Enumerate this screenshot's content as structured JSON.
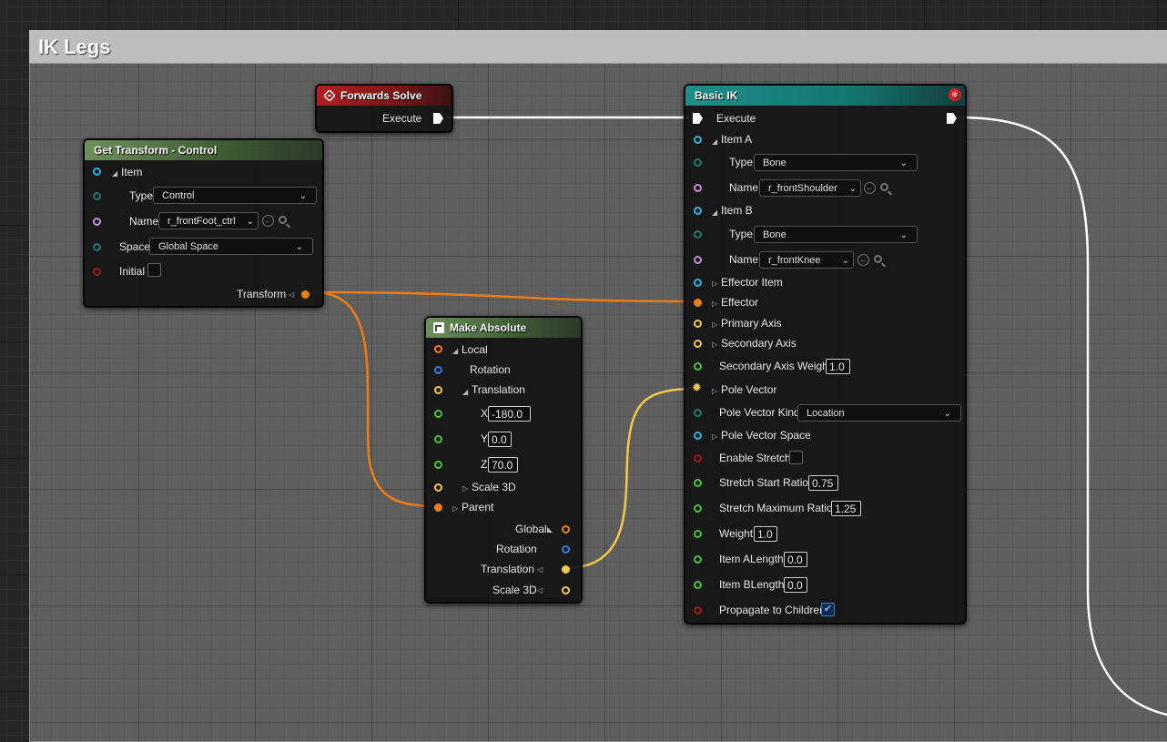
{
  "comment": {
    "title": "IK Legs"
  },
  "colors": {
    "exec": "#ffffff",
    "transform": "#f07d14",
    "vector": "#f5c84a",
    "rotation": "#2f7fe0",
    "item": "#2ab6e0",
    "type": "#1e7a70",
    "name": "#c58be0",
    "bool": "#a01818",
    "float": "#49c43a"
  },
  "forwards_solve": {
    "title": "Forwards Solve",
    "execute": "Execute"
  },
  "get_transform": {
    "title": "Get Transform - Control",
    "item": "Item",
    "type_label": "Type",
    "type_value": "Control",
    "name_label": "Name",
    "name_value": "r_frontFoot_ctrl",
    "space_label": "Space",
    "space_value": "Global Space",
    "initial_label": "Initial",
    "transform_label": "Transform"
  },
  "make_absolute": {
    "title": "Make Absolute",
    "local": "Local",
    "rotation": "Rotation",
    "translation": "Translation",
    "x_label": "X",
    "x_value": "-180.0",
    "y_label": "Y",
    "y_value": "0.0",
    "z_label": "Z",
    "z_value": "70.0",
    "scale3d": "Scale 3D",
    "parent": "Parent",
    "out_global": "Global",
    "out_rotation": "Rotation",
    "out_translation": "Translation",
    "out_scale3d": "Scale 3D"
  },
  "basic_ik": {
    "title": "Basic IK",
    "execute": "Execute",
    "item_a": "Item A",
    "type_label": "Type",
    "item_a_type": "Bone",
    "name_label": "Name",
    "item_a_name": "r_frontShoulder",
    "item_b": "Item B",
    "item_b_type": "Bone",
    "item_b_name": "r_frontKnee",
    "effector_item": "Effector Item",
    "effector": "Effector",
    "primary_axis": "Primary Axis",
    "secondary_axis": "Secondary Axis",
    "secondary_axis_weight": "Secondary Axis Weight",
    "secondary_axis_weight_value": "1.0",
    "pole_vector": "Pole Vector",
    "pole_vector_kind": "Pole Vector Kind",
    "pole_vector_kind_value": "Location",
    "pole_vector_space": "Pole Vector Space",
    "enable_stretch": "Enable Stretch",
    "stretch_start_ratio": "Stretch Start Ratio",
    "stretch_start_ratio_value": "0.75",
    "stretch_maximum_ratio": "Stretch Maximum Ratio",
    "stretch_maximum_ratio_value": "1.25",
    "weight": "Weight",
    "weight_value": "1.0",
    "item_alength": "Item ALength",
    "item_alength_value": "0.0",
    "item_blength": "Item BLength",
    "item_blength_value": "0.0",
    "propagate": "Propagate to Children",
    "propagate_checked": true
  }
}
